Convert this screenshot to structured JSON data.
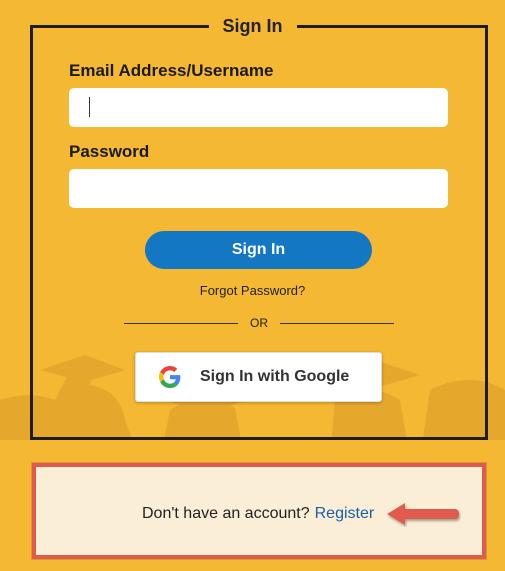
{
  "signin": {
    "title": "Sign In",
    "email_label": "Email Address/Username",
    "email_value": "",
    "password_label": "Password",
    "password_value": "",
    "submit_label": "Sign In",
    "forgot_label": "Forgot Password?",
    "or_label": "OR",
    "google_label": "Sign In with Google",
    "google_icon": "google-g-icon"
  },
  "register": {
    "prompt": "Don't have an account?",
    "link_label": "Register"
  },
  "colors": {
    "background": "#f5b832",
    "primary_button": "#1477c4",
    "highlight_border": "#e05a4e",
    "register_panel": "#faeed6",
    "link": "#1a5fa8"
  }
}
